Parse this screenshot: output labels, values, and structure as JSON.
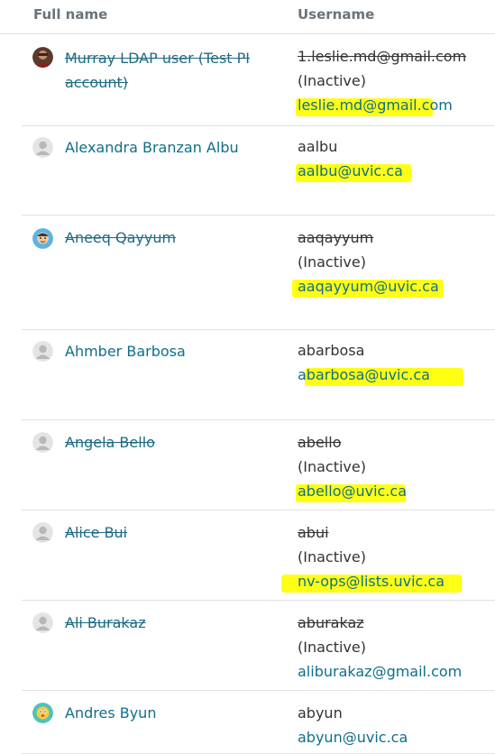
{
  "header": {
    "fullname_label": "Full name",
    "username_label": "Username"
  },
  "users": [
    {
      "fullname": "Murray LDAP user (Test PI account)",
      "username": "1.leslie.md@gmail.com",
      "status": "(Inactive)",
      "email": "leslie.md@gmail.com",
      "suspended": true,
      "avatar": "photo"
    },
    {
      "fullname": "Alexandra Branzan Albu",
      "username": "aalbu",
      "status": "",
      "email": "aalbu@uvic.ca",
      "suspended": false,
      "avatar": "default"
    },
    {
      "fullname": "Aneeq Qayyum",
      "username": "aaqayyum",
      "status": "(Inactive)",
      "email": "aaqayyum@uvic.ca",
      "suspended": true,
      "avatar": "emoji-person"
    },
    {
      "fullname": "Ahmber Barbosa",
      "username": "abarbosa",
      "status": "",
      "email": "abarbosa@uvic.ca",
      "suspended": false,
      "avatar": "default"
    },
    {
      "fullname": "Angela Bello",
      "username": "abello",
      "status": "(Inactive)",
      "email": "abello@uvic.ca",
      "suspended": true,
      "avatar": "default"
    },
    {
      "fullname": "Alice Bui",
      "username": "abui",
      "status": "(Inactive)",
      "email": "nv-ops@lists.uvic.ca",
      "suspended": true,
      "avatar": "default"
    },
    {
      "fullname": "Ali Burakaz",
      "username": "aburakaz",
      "status": "(Inactive)",
      "email": "aliburakaz@gmail.com",
      "suspended": true,
      "avatar": "default"
    },
    {
      "fullname": "Andres Byun",
      "username": "abyun",
      "status": "",
      "email": "abyun@uvic.ca",
      "suspended": false,
      "avatar": "emoji-face"
    }
  ],
  "colors": {
    "link": "#0f6f8a",
    "highlight": "#ffff00",
    "border": "#dee2e6"
  }
}
